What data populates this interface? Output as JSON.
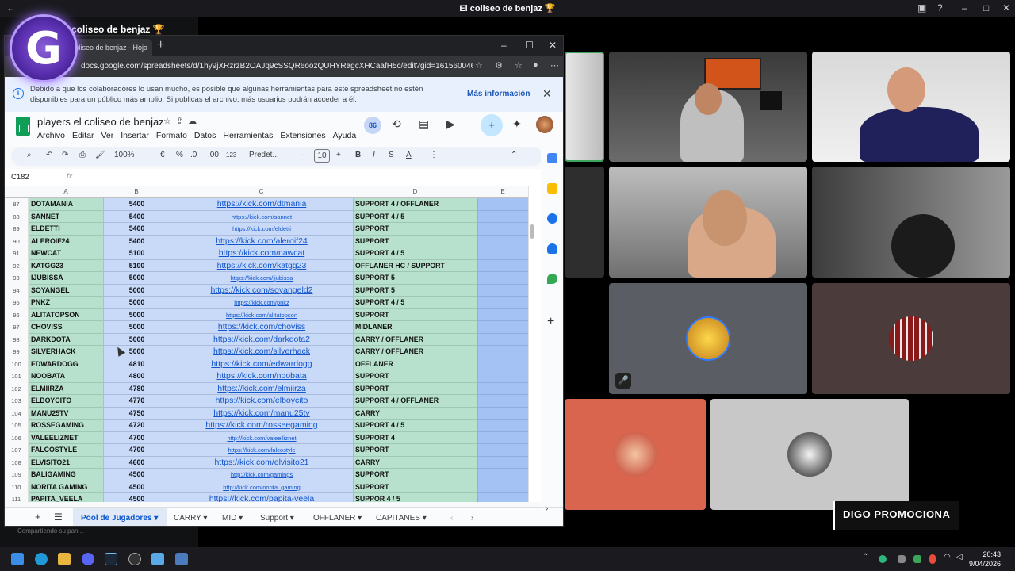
{
  "outer": {
    "title": "El coliseo de benjaz 🏆",
    "server_name": "coliseo de benjaz 🏆",
    "logo_letter": "G",
    "sharing": "Compartiendo su pan..."
  },
  "browser": {
    "tab_title": "coliseo de benjaz - Hoja",
    "url": "docs.google.com/spreadsheets/d/1hy9jXRzrzB2OAJq9cSSQR6oozQUHYRagcXHCaafH5c/edit?gid=1615600466#gi..."
  },
  "notice": {
    "text": "Debido a que los colaboradores lo usan mucho, es posible que algunas herramientas para este spreadsheet no estén disponibles para un público más amplio. Si publicas el archivo, más usuarios podrán acceder a él.",
    "more": "Más información"
  },
  "sheet": {
    "title": "players el coliseo de benjaz",
    "menu": [
      "Archivo",
      "Editar",
      "Ver",
      "Insertar",
      "Formato",
      "Datos",
      "Herramientas",
      "Extensiones",
      "Ayuda"
    ],
    "viewers": "86",
    "zoom": "100%",
    "currency": "€",
    "percent": "%",
    "dec_less": ".0",
    "dec_more": ".00",
    "num_format": "123",
    "font": "Predet...",
    "font_size": "10",
    "cell_ref": "C182",
    "fx": "fx",
    "columns": [
      "A",
      "B",
      "C",
      "D",
      "E"
    ],
    "rows": [
      {
        "n": "87",
        "a": "DOTAMANIA",
        "b": "5400",
        "c": "https://kick.com/dtmania",
        "d": "SUPPORT 4 / OFFLANER",
        "s": "big"
      },
      {
        "n": "88",
        "a": "SANNET",
        "b": "5400",
        "c": "https://kick.com/sannet",
        "d": "SUPPORT 4 / 5",
        "s": "small"
      },
      {
        "n": "89",
        "a": "ELDETTI",
        "b": "5400",
        "c": "https://kick.com/eldetti",
        "d": "SUPPORT",
        "s": "small"
      },
      {
        "n": "90",
        "a": "ALEROIF24",
        "b": "5400",
        "c": "https://kick.com/aleroif24",
        "d": "SUPPORT",
        "s": "big"
      },
      {
        "n": "91",
        "a": "NEWCAT",
        "b": "5100",
        "c": "https://kick.com/nawcat",
        "d": "SUPPORT 4 / 5",
        "s": "big"
      },
      {
        "n": "92",
        "a": "KATGG23",
        "b": "5100",
        "c": "https://kick.com/katgg23",
        "d": "OFFLANER HC / SUPPORT",
        "s": "big"
      },
      {
        "n": "93",
        "a": "IJUBISSA",
        "b": "5000",
        "c": "https://kick.com/ijubissa",
        "d": "SUPPORT 5",
        "s": "small"
      },
      {
        "n": "94",
        "a": "SOYANGEL",
        "b": "5000",
        "c": "https://kick.com/soyangeld2",
        "d": "SUPPORT 5",
        "s": "big"
      },
      {
        "n": "95",
        "a": "PNKZ",
        "b": "5000",
        "c": "https://kick.com/pnkz",
        "d": "SUPPORT 4 / 5",
        "s": "small"
      },
      {
        "n": "96",
        "a": "ALITATOPSON",
        "b": "5000",
        "c": "https://kick.com/alitatopson",
        "d": "SUPPORT",
        "s": "small"
      },
      {
        "n": "97",
        "a": "CHOVISS",
        "b": "5000",
        "c": "https://kick.com/choviss",
        "d": "MIDLANER",
        "s": "big"
      },
      {
        "n": "98",
        "a": "DARKDOTA",
        "b": "5000",
        "c": "https://kick.com/darkdota2",
        "d": "CARRY / OFFLANER",
        "s": "big"
      },
      {
        "n": "99",
        "a": "SILVERHACK",
        "b": "5000",
        "c": "https://kick.com/silverhack",
        "d": "CARRY / OFFLANER",
        "s": "big"
      },
      {
        "n": "100",
        "a": "EDWARDOGG",
        "b": "4810",
        "c": "https://kick.com/edwardogg",
        "d": "OFFLANER",
        "s": "big"
      },
      {
        "n": "101",
        "a": "NOOBATA",
        "b": "4800",
        "c": "https://kick.com/noobata",
        "d": "SUPPORT",
        "s": "big"
      },
      {
        "n": "102",
        "a": "ELMIIRZA",
        "b": "4780",
        "c": "https://kick.com/elmiirza",
        "d": "SUPPORT",
        "s": "big"
      },
      {
        "n": "103",
        "a": "ELBOYCITO",
        "b": "4770",
        "c": "https://kick.com/elboycito",
        "d": "SUPPORT 4 / OFFLANER",
        "s": "big"
      },
      {
        "n": "104",
        "a": "MANU25TV",
        "b": "4750",
        "c": "https://kick.com/manu25tv",
        "d": "CARRY",
        "s": "big"
      },
      {
        "n": "105",
        "a": "ROSSEGAMING",
        "b": "4720",
        "c": "https://kick.com/rosseegaming",
        "d": "SUPPORT 4 / 5",
        "s": "big"
      },
      {
        "n": "106",
        "a": "VALEELIZNET",
        "b": "4700",
        "c": "http://kick.com/valeelliznet",
        "d": "SUPPORT 4",
        "s": "small"
      },
      {
        "n": "107",
        "a": "FALCOSTYLE",
        "b": "4700",
        "c": "https://kick.com/falcostyle",
        "d": "SUPPORT",
        "s": "small"
      },
      {
        "n": "108",
        "a": "ELVISITO21",
        "b": "4600",
        "c": "https://kick.com/elvisito21",
        "d": "CARRY",
        "s": "big"
      },
      {
        "n": "109",
        "a": "BALIGAMING",
        "b": "4500",
        "c": "http://kick.com/gamings",
        "d": "SUPPORT",
        "s": "small"
      },
      {
        "n": "110",
        "a": "NORITA GAMING",
        "b": "4500",
        "c": "http://kick.com/norita_gaming",
        "d": "SUPPORT",
        "s": "small"
      },
      {
        "n": "111",
        "a": "PAPITA_VEELA",
        "b": "4500",
        "c": "https://kick.com/papita-veela",
        "d": "SUPPOR 4 / 5",
        "s": "big"
      }
    ],
    "tabs": [
      "Pool de Jugadores",
      "CARRY",
      "MID",
      "Support",
      "OFFLANER",
      "CAPITANES"
    ]
  },
  "promo": "DIGO PROMOCIONA",
  "clock": {
    "time": "20:43",
    "date": "9/04/2026"
  }
}
